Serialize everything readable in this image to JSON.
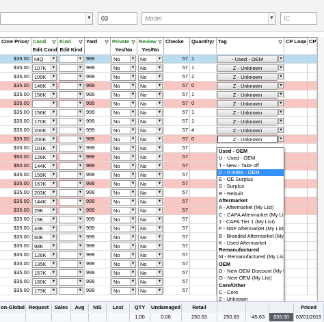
{
  "filters": {
    "field1_value": "",
    "field2_value": "03",
    "model_placeholder": "Model",
    "field4_value": "IC"
  },
  "columns": {
    "core_price": "Core Price",
    "cond": "Cond",
    "kind": "Kind",
    "yard": "Yard",
    "private": "Private",
    "review": "Review",
    "checked": "Checke",
    "quantity": "Quantity",
    "tag": "Tag",
    "cp_loc": "CP Loca",
    "cp_r": "CP R"
  },
  "subheaders": {
    "edit_cond": "Edit Cond...",
    "edit_kind": "Edit Kind",
    "yes_no_private": "Yes/No",
    "yes_no_review": "Yes/No"
  },
  "rows": [
    {
      "price": "$35.00",
      "cond": "NIQ",
      "yard": "999",
      "private": "No",
      "review": "No",
      "checked": "57",
      "qty": "1",
      "tag": "- Used - OEM",
      "style": "blue"
    },
    {
      "price": "$35.00",
      "cond": "107K",
      "yard": "999",
      "private": "No",
      "review": "No",
      "checked": "57",
      "qty": "1",
      "tag": "Z - Unknown",
      "style": ""
    },
    {
      "price": "$35.00",
      "cond": "109K",
      "yard": "999",
      "private": "No",
      "review": "No",
      "checked": "57",
      "qty": "2",
      "tag": "Z - Unknown",
      "style": ""
    },
    {
      "price": "$35.00",
      "cond": "148K",
      "yard": "999",
      "private": "No",
      "review": "No",
      "checked": "57",
      "qty": "0",
      "tag": "Z - Unknown",
      "style": "pink"
    },
    {
      "price": "$35.00",
      "cond": "156K",
      "yard": "999",
      "private": "No",
      "review": "No",
      "checked": "57",
      "qty": "1",
      "tag": "Z - Unknown",
      "style": ""
    },
    {
      "price": "$35.00",
      "cond": "",
      "yard": "999",
      "private": "No",
      "review": "No",
      "checked": "57",
      "qty": "0",
      "tag": "Z - Unknown",
      "style": "pink"
    },
    {
      "price": "$35.00",
      "cond": "156K",
      "yard": "999",
      "private": "No",
      "review": "No",
      "checked": "57",
      "qty": "1",
      "tag": "Z - Unknown",
      "style": ""
    },
    {
      "price": "$35.00",
      "cond": "170K",
      "yard": "999",
      "private": "No",
      "review": "No",
      "checked": "57",
      "qty": "1",
      "tag": "Z - Unknown",
      "style": ""
    },
    {
      "price": "$35.00",
      "cond": "200K",
      "yard": "999",
      "private": "No",
      "review": "No",
      "checked": "57",
      "qty": "4",
      "tag": "Z - Unknown",
      "style": ""
    },
    {
      "price": "$35.00",
      "cond": "200K",
      "yard": "999",
      "private": "No",
      "review": "No",
      "checked": "57",
      "qty": "0",
      "tag": "Z - Unknown",
      "style": "pink"
    },
    {
      "price": "$35.00",
      "cond": "101K",
      "yard": "999",
      "private": "No",
      "review": "No",
      "checked": "57",
      "qty": "",
      "tag": "",
      "style": ""
    },
    {
      "price": "$50.00",
      "cond": "126K",
      "yard": "999",
      "private": "No",
      "review": "No",
      "checked": "57",
      "qty": "",
      "tag": "",
      "style": "pink"
    },
    {
      "price": "$50.00",
      "cond": "144K",
      "yard": "999",
      "private": "No",
      "review": "No",
      "checked": "57",
      "qty": "",
      "tag": "",
      "style": "pink"
    },
    {
      "price": "$35.00",
      "cond": "159K",
      "yard": "999",
      "private": "No",
      "review": "No",
      "checked": "57",
      "qty": "",
      "tag": "",
      "style": ""
    },
    {
      "price": "$35.00",
      "cond": "167K",
      "yard": "999",
      "private": "No",
      "review": "No",
      "checked": "57",
      "qty": "",
      "tag": "",
      "style": "pink"
    },
    {
      "price": "$35.00",
      "cond": "203K",
      "yard": "999",
      "private": "No",
      "review": "No",
      "checked": "57",
      "qty": "",
      "tag": "",
      "style": ""
    },
    {
      "price": "$35.00",
      "cond": "144K",
      "yard": "999",
      "private": "No",
      "review": "No",
      "checked": "57",
      "qty": "",
      "tag": "",
      "style": "pink"
    },
    {
      "price": "$35.00",
      "cond": "29K",
      "yard": "999",
      "private": "No",
      "review": "No",
      "checked": "57",
      "qty": "",
      "tag": "",
      "style": "pink"
    },
    {
      "price": "$35.00",
      "cond": "15K",
      "yard": "999",
      "private": "No",
      "review": "No",
      "checked": "57",
      "qty": "",
      "tag": "",
      "style": ""
    },
    {
      "price": "$35.00",
      "cond": "43K",
      "yard": "999",
      "private": "No",
      "review": "No",
      "checked": "57",
      "qty": "",
      "tag": "",
      "style": ""
    },
    {
      "price": "$35.00",
      "cond": "50K",
      "yard": "999",
      "private": "No",
      "review": "No",
      "checked": "57",
      "qty": "",
      "tag": "",
      "style": ""
    },
    {
      "price": "$35.00",
      "cond": "98K",
      "yard": "999",
      "private": "No",
      "review": "No",
      "checked": "57",
      "qty": "",
      "tag": "",
      "style": ""
    },
    {
      "price": "$35.00",
      "cond": "126K",
      "yard": "999",
      "private": "No",
      "review": "No",
      "checked": "57",
      "qty": "",
      "tag": "",
      "style": ""
    },
    {
      "price": "$35.00",
      "cond": "135K",
      "yard": "999",
      "private": "No",
      "review": "No",
      "checked": "57",
      "qty": "",
      "tag": "",
      "style": ""
    },
    {
      "price": "$35.00",
      "cond": "157K",
      "yard": "999",
      "private": "No",
      "review": "No",
      "checked": "57",
      "qty": "",
      "tag": "",
      "style": ""
    },
    {
      "price": "$35.00",
      "cond": "160K",
      "yard": "999",
      "private": "No",
      "review": "No",
      "checked": "57",
      "qty": "",
      "tag": "",
      "style": ""
    },
    {
      "price": "$35.00",
      "cond": "173K",
      "yard": "999",
      "private": "No",
      "review": "No",
      "checked": "57",
      "qty": "",
      "tag": "",
      "style": ""
    }
  ],
  "tag_popup": [
    {
      "label": "Used - OEM",
      "kind": "grp"
    },
    {
      "label": "U - Used - OEM",
      "kind": ""
    },
    {
      "label": "T - New - Take off",
      "kind": ""
    },
    {
      "label": "D - 0 miles - OEM",
      "kind": "sel"
    },
    {
      "label": "E - OE Surplus",
      "kind": ""
    },
    {
      "label": "S - Surplus",
      "kind": ""
    },
    {
      "label": "R - Rebuilt",
      "kind": ""
    },
    {
      "label": "Aftermarket",
      "kind": "grp"
    },
    {
      "label": "A - Aftermarket (My List)",
      "kind": ""
    },
    {
      "label": "C - CAPA Aftermarket (My List)",
      "kind": ""
    },
    {
      "label": "1 - CAPA Tier 1 (My List)",
      "kind": ""
    },
    {
      "label": "F - NSF Aftermarket (My List)",
      "kind": ""
    },
    {
      "label": "B - Branded Aftermarket (My List)",
      "kind": ""
    },
    {
      "label": "K - Used Aftermarket",
      "kind": ""
    },
    {
      "label": "Remanufactured",
      "kind": "grp"
    },
    {
      "label": "M - Remanufactured (My List)",
      "kind": ""
    },
    {
      "label": "OEM",
      "kind": "grp"
    },
    {
      "label": "D - New OEM Discount (My List)",
      "kind": ""
    },
    {
      "label": "O - New OEM (My List)",
      "kind": ""
    },
    {
      "label": "Core/Other",
      "kind": "grp"
    },
    {
      "label": "C - Core",
      "kind": ""
    },
    {
      "label": "Z - Unknown",
      "kind": ""
    }
  ],
  "footer": {
    "headers": [
      "on-Global",
      "Request",
      "Sales",
      "Avg",
      "NIS",
      "Lost",
      "QTY",
      "Undamaged",
      "Retail",
      "",
      "",
      "",
      "Priced"
    ],
    "values": [
      "",
      "",
      "",
      "",
      "",
      "",
      "1.00",
      "0.00",
      "250.63",
      "250.63",
      "-45.63",
      "$35.00",
      "03/01/2015"
    ]
  },
  "colors": {
    "pink_row": "#f8c6c3",
    "blue_row": "#b9dcef",
    "selected": "#3390ff",
    "green_header": "#1a7a1a"
  }
}
